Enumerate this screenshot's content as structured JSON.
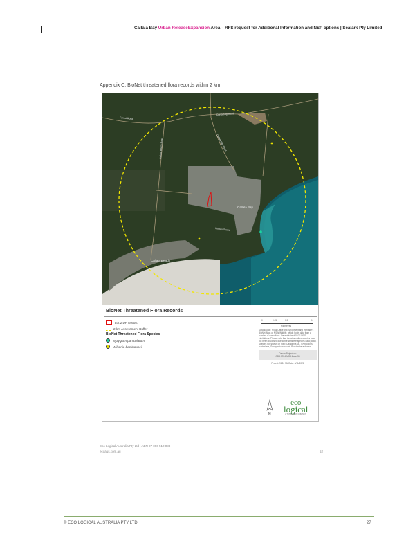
{
  "header": {
    "prefix": "Callala Bay ",
    "inserted": "Urban Release",
    "inserted2": "Expansion",
    "suffix": " Area – RFS request for Additional Information and NSP options | Sealark Pty Limited"
  },
  "appendix_title": "Appendix C: BioNet threatened flora records within 2 km",
  "map": {
    "labels": {
      "forest_road": "Forest Road",
      "currarong_road": "Currarong Road",
      "callala_beach_road": "Callala Beach Road",
      "callala_bay_road": "Callala Bay Road",
      "murray_street": "Murray Street",
      "callala_bay": "Callala Bay",
      "callala_beach": "Callala Beach"
    },
    "colors": {
      "buffer": "#f2e600",
      "lot": "#e01010",
      "syzygium": "#1ad6a0",
      "wilsonia": "#e8e000"
    }
  },
  "legend": {
    "title": "BioNet Threatened Flora Records",
    "lot": "Lot 2 DP 846057",
    "buffer": "2 km Assessment Buffer",
    "species_heading": "BioNet Threatened Flora Species",
    "species": [
      "Syzygium paniculatum",
      "Wilsonia backhousei"
    ]
  },
  "scale": {
    "ticks": [
      "0",
      "0.25",
      "0.5",
      "1"
    ],
    "unit": "Kilometres"
  },
  "notes": {
    "data_source": "Data source: NSW Office of Environment and Heritage's BioNet Atlas of NSW Wildlife, which holds data from a number of custodians. Data obtained 04/11/2020.",
    "limitations": "Limitations: Please note that threat sensitive species have not been disclosed due to the sensitive species data policy.",
    "not_shown": "Species not shown on map: Caladenia sp., Cryptostylis hunteriana, Genoplesium baueri, Prostanthera densa."
  },
  "datum": {
    "label": "Datum/Projection:",
    "value": "GDA 1994 MGA Zone 56"
  },
  "project": "Project: 9124 ML  Date: 4/11/2021",
  "north": "N",
  "logo": {
    "line1": "eco",
    "line2": "logical",
    "tag": "A TETRA TECH COMPANY"
  },
  "inner_footer": {
    "company": "Eco Logical Australia Pty Ltd  |  ABN 87 096 512 088",
    "site": "ecoaus.com.au",
    "page": "52"
  },
  "footer": {
    "copyright": "© ECO LOGICAL AUSTRALIA PTY LTD",
    "page": "27"
  }
}
